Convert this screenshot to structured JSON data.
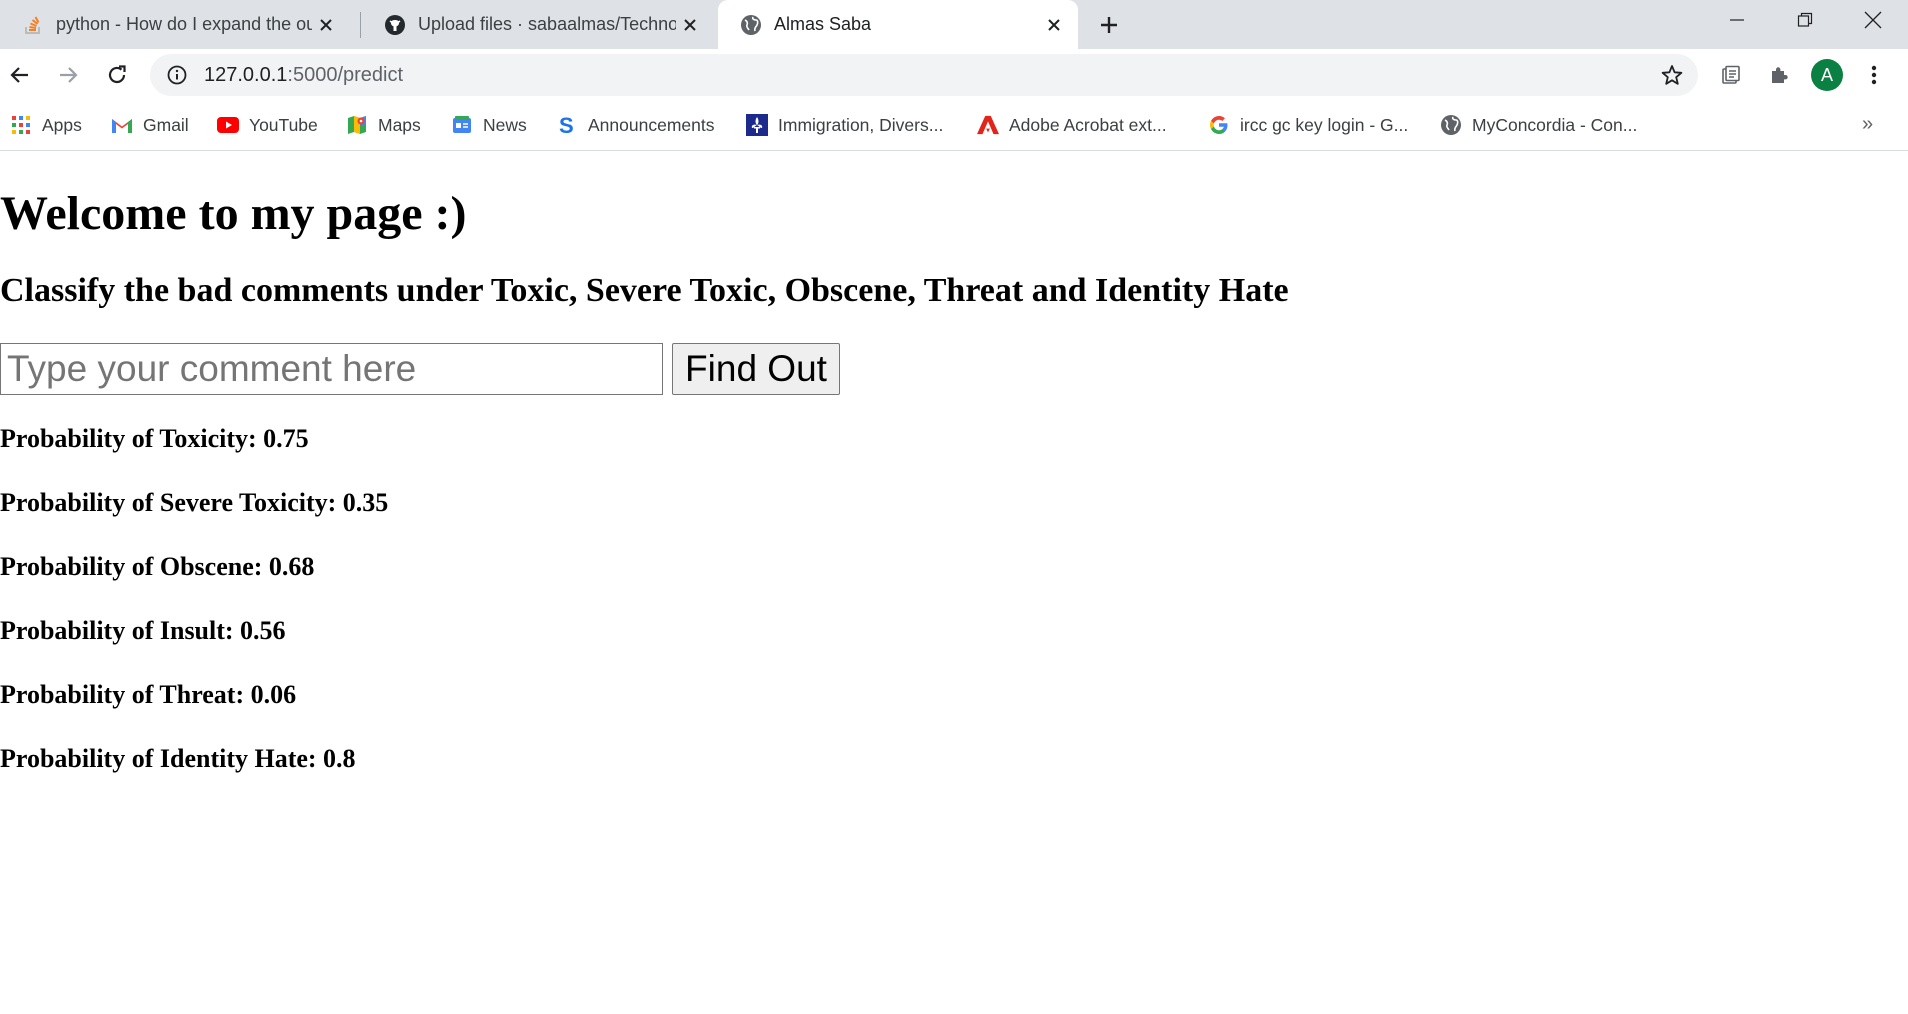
{
  "browser": {
    "tabs": [
      {
        "title": "python - How do I expand the output display to see more columns",
        "favicon": "stackoverflow-icon",
        "active": false
      },
      {
        "title": "Upload files · sabaalmas/Technocolabs",
        "favicon": "github-icon",
        "active": false
      },
      {
        "title": "Almas Saba",
        "favicon": "globe-icon",
        "active": true
      }
    ],
    "url_host": "127.0.0.1",
    "url_path": ":5000/predict",
    "profile_initial": "A",
    "bookmarks": [
      {
        "label": "Apps",
        "icon": "apps-grid-icon"
      },
      {
        "label": "Gmail",
        "icon": "gmail-icon"
      },
      {
        "label": "YouTube",
        "icon": "youtube-icon"
      },
      {
        "label": "Maps",
        "icon": "maps-icon"
      },
      {
        "label": "News",
        "icon": "news-icon"
      },
      {
        "label": "Announcements",
        "icon": "announcements-icon"
      },
      {
        "label": "Immigration, Divers...",
        "icon": "fleur-de-lis-icon"
      },
      {
        "label": "Adobe Acrobat ext...",
        "icon": "acrobat-icon"
      },
      {
        "label": "ircc gc key login - G...",
        "icon": "google-icon"
      },
      {
        "label": "MyConcordia - Con...",
        "icon": "globe-icon"
      }
    ],
    "more_bookmarks": "»"
  },
  "page": {
    "heading": "Welcome to my page :)",
    "subheading": "Classify the bad comments under Toxic, Severe Toxic, Obscene, Threat and Identity Hate",
    "input_placeholder": "Type your comment here",
    "input_value": "",
    "button_label": "Find Out",
    "results": [
      "Probability of Toxicity: 0.75",
      "Probability of Severe Toxicity: 0.35",
      "Probability of Obscene: 0.68",
      "Probability of Insult: 0.56",
      "Probability of Threat: 0.06",
      "Probability of Identity Hate: 0.8"
    ]
  },
  "colors": {
    "tabstrip": "#dee1e6",
    "omnibox": "#f1f3f4",
    "avatar": "#0b8043"
  }
}
